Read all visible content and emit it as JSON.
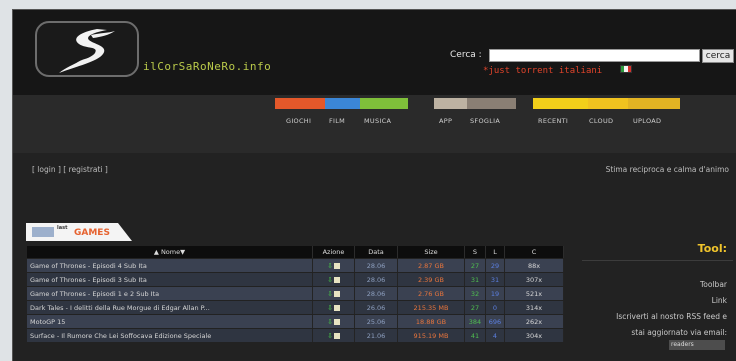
{
  "header": {
    "site_name": "ilCorSaRoNeRo.info",
    "search_label": "Cerca :",
    "search_value": "",
    "search_button": "cerca",
    "tagline": "*just torrent italiani"
  },
  "nav": [
    {
      "label": "GIOCHI",
      "color": "#e4582a"
    },
    {
      "label": "FILM",
      "color": "#3b86d6"
    },
    {
      "label": "MUSICA",
      "color": "#7fbf3a"
    },
    {
      "label": "APP",
      "color": "#bdb2a2"
    },
    {
      "label": "SFOGLIA",
      "color": "#8a7f74"
    },
    {
      "label": "RECENTI",
      "color": "#f2cf1a"
    },
    {
      "label": "CLOUD",
      "color": "#f0c21f"
    },
    {
      "label": "UPLOAD",
      "color": "#e2b323"
    }
  ],
  "account": {
    "login": "[ login ]",
    "register": "[ registrati ]",
    "motto": "Stima reciproca e calma d'animo"
  },
  "section": {
    "small_label": "last",
    "title": "GAMES"
  },
  "table": {
    "columns": [
      "▲ Nome▼",
      "Azione",
      "Data",
      "Size",
      "S",
      "L",
      "C"
    ],
    "rows": [
      {
        "name": "Game of Thrones - Episodi 4 Sub Ita",
        "date": "28.06",
        "size": "2.87 GB",
        "s": "27",
        "l": "29",
        "c": "88x"
      },
      {
        "name": "Game of Thrones - Episodi 3 Sub Ita",
        "date": "28.06",
        "size": "2.39 GB",
        "s": "31",
        "l": "31",
        "c": "307x"
      },
      {
        "name": "Game of Thrones - Episodi 1 e 2 Sub Ita",
        "date": "28.06",
        "size": "2.76 GB",
        "s": "32",
        "l": "19",
        "c": "521x"
      },
      {
        "name": "Dark Tales - I delitti della Rue Morgue di Edgar Allan P...",
        "date": "26.06",
        "size": "215.35 MB",
        "s": "27",
        "l": "0",
        "c": "314x"
      },
      {
        "name": "MotoGP 15",
        "date": "25.06",
        "size": "18.88 GB",
        "s": "384",
        "l": "696",
        "c": "262x"
      },
      {
        "name": "Surface - Il Rumore Che Lei Soffocava Edizione Speciale",
        "date": "21.06",
        "size": "915.19 MB",
        "s": "41",
        "l": "4",
        "c": "304x"
      }
    ]
  },
  "tool": {
    "title": "Tool:",
    "toolbar": "Toolbar",
    "link": "Link",
    "rss_line1": "Iscriverti al nostro RSS feed e",
    "rss_line2": "stai aggiornato via email:",
    "rss_badge_text": "readers"
  },
  "icons": {
    "logo": "tribal-s-logo-icon",
    "flag": "italian-flag-icon",
    "download": "download-arrow-icon",
    "magnet": "magnet-box-icon"
  }
}
